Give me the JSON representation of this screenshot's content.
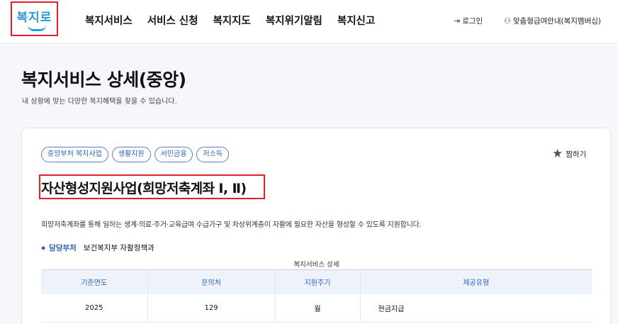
{
  "logo": {
    "text": "복지로"
  },
  "nav": [
    "복지서비스",
    "서비스 신청",
    "복지지도",
    "복지위기알림",
    "복지신고"
  ],
  "utility": {
    "login": "로그인",
    "member_guide": "맞춤형급여안내(복지멤버십)",
    "login_icon": "login-arrow-icon",
    "member_icon": "user-plus-icon"
  },
  "page": {
    "title": "복지서비스 상세(중앙)",
    "description": "내 상황에 맞는 다양한 복지혜택을 찾을 수 있습니다."
  },
  "service": {
    "tags": [
      "중앙부처 복지사업",
      "생활지원",
      "서민금융",
      "저소득"
    ],
    "favorite_label": "찜하기",
    "title": "자산형성지원사업(희망저축계좌 Ⅰ, Ⅱ)",
    "description": "희망저축계좌를 통해 일하는 생계·의료·주거·교육급여 수급가구 및 차상위계층이 자활에 필요한 자산을 형성할 수 있도록 지원합니다.",
    "dept_label": "담당부처",
    "dept_value": "보건복지부 자활정책과"
  },
  "detail_table": {
    "caption": "복지서비스 상세",
    "headers": [
      "기준연도",
      "문의처",
      "지원주기",
      "제공유형"
    ],
    "rows": [
      [
        "2025",
        "129",
        "월",
        "현금지급"
      ]
    ]
  },
  "colors": {
    "accent": "#2c5fb8",
    "highlight_border": "#e0202a",
    "logo": "#1fa0dc"
  }
}
